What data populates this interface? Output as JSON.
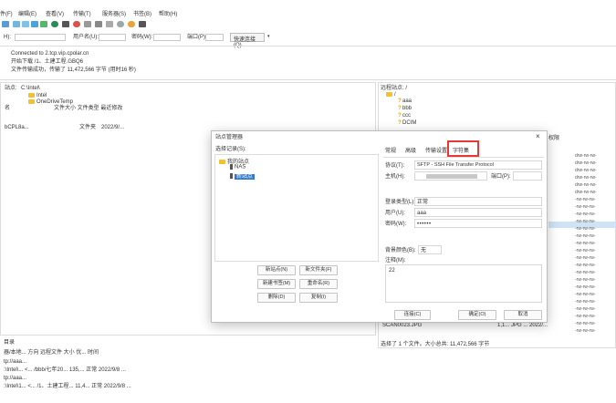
{
  "menu": [
    "件(F)",
    "编辑(E)",
    "查看(V)",
    "传输(T)",
    "服务器(S)",
    "书签(B)",
    "帮助(H)"
  ],
  "quickconnect": {
    "host_label": "H):",
    "user_label": "用户名(U):",
    "pass_label": "密码(W):",
    "port_label": "端口(P):",
    "button_label": "快速连接(Q)",
    "dropdown_glyph": "▾"
  },
  "log": [
    "Connected to 2.tcp.vip.cpolar.cn",
    "开始下载 /1、土建工程.GBQ6",
    "文件传输成功，传输了 11,472,566 字节 (用时16 秒)"
  ],
  "local": {
    "site_label": "站点:",
    "site_path": "C:\\Intel\\",
    "tree": [
      "Intel",
      "OneDriveTemp"
    ],
    "columns_prefix": "名",
    "columns": "文件大小  文件类型  最近修改",
    "row_name": "bCPL8a...",
    "row_type": "文件夹",
    "row_date": "2022/9/..."
  },
  "remote": {
    "site_label": "远程站点: /",
    "root": "/",
    "items": [
      "aaa",
      "bbb",
      "ccc",
      "DCIM"
    ],
    "perm_header": "权限",
    "perms": [
      "drw-rw-rw-",
      "drw-rw-rw-",
      "drw-rw-rw-",
      "drw-rw-rw-",
      "drw-rw-rw-",
      "drw-rw-rw-",
      "-rw-rw-rw-",
      "-rw-rw-rw-",
      "-rw-rw-rw-",
      "-rw-rw-rw-",
      "-rw-rw-rw-",
      "-rw-rw-rw-",
      "-rw-rw-rw-",
      "-rw-rw-rw-",
      "-rw-rw-rw-",
      "-rw-rw-rw-",
      "-rw-rw-rw-",
      "-rw-rw-rw-",
      "-rw-rw-rw-",
      "-rw-rw-rw-",
      "-rw-rw-rw-",
      "-rw-rw-rw-",
      "-rw-rw-rw-",
      "-rw-rw-rw-",
      "-rw-rw-rw-"
    ],
    "file_row1": "SCAN0023.JPG",
    "file_row1_meta": "1,1...  JPG ...  2022/...",
    "status": "选择了 1 个文件。大小总共: 11,472,566 字节"
  },
  "queue": {
    "title": "目录",
    "header": "器/本地...  方向  远程文件            大小  优...  时间",
    "rows": [
      "tp://aaa...",
      ":\\Intel\\...   <...   /bbb/七年20...   135,...  正常  2022/9/8 ...",
      "tp://aaa...",
      ":\\Intel\\1...  <...   /1、土建工程...  11,4...  正常  2022/9/8 ..."
    ]
  },
  "dialog": {
    "title": "站点管理器",
    "close": "×",
    "select_label": "选择记录(S):",
    "tree_root": "我的站点",
    "tree_items": [
      "NAS",
      "新站点"
    ],
    "tabs": [
      "常规",
      "高级",
      "传输设置",
      "字符集"
    ],
    "protocol_label": "协议(T):",
    "protocol_value": "SFTP - SSH File Transfer Protocol",
    "host_label": "主机(H):",
    "port_label": "端口(P):",
    "logon_label": "登录类型(L):",
    "logon_value": "正常",
    "user_label": "用户(U):",
    "user_value": "aaa",
    "pass_label": "密码(W):",
    "pass_value": "••••••",
    "bg_label": "背景颜色(B):",
    "bg_value": "无",
    "comment_label": "注释(M):",
    "comment_value": "22",
    "buttons": [
      "新站点(N)",
      "新文件夹(F)",
      "新建书签(M)",
      "重命名(R)",
      "删除(D)",
      "复制(I)"
    ],
    "connect": "连接(C)",
    "ok": "确定(O)",
    "cancel": "取消"
  }
}
